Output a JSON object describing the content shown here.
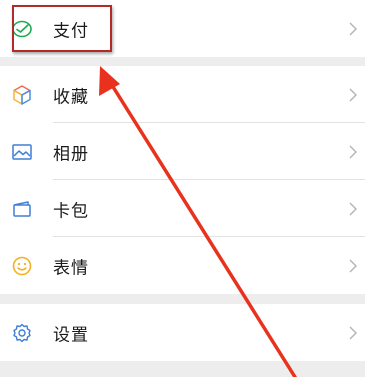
{
  "menu": {
    "group1": [
      {
        "label": "支付",
        "icon": "pay-check-icon"
      }
    ],
    "group2": [
      {
        "label": "收藏",
        "icon": "cube-icon"
      },
      {
        "label": "相册",
        "icon": "picture-icon"
      },
      {
        "label": "卡包",
        "icon": "card-icon"
      },
      {
        "label": "表情",
        "icon": "smile-icon"
      }
    ],
    "group3": [
      {
        "label": "设置",
        "icon": "gear-icon"
      }
    ]
  },
  "annotation": {
    "highlight_color": "#b22a2a",
    "arrow_color": "#e8321e"
  },
  "colors": {
    "accent_green": "#1aad4f",
    "background": "#ededed"
  }
}
